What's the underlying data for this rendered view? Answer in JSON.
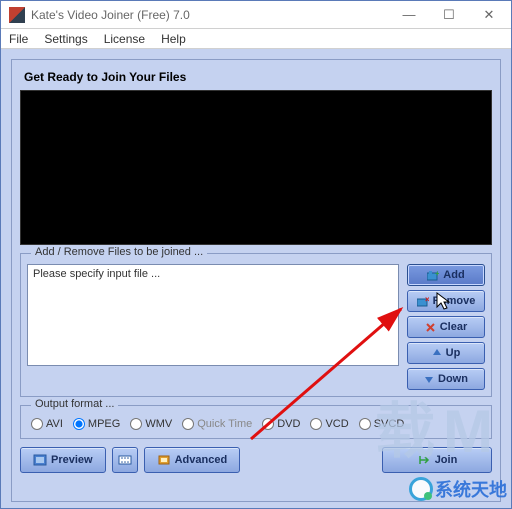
{
  "window": {
    "title": "Kate's Video Joiner (Free) 7.0"
  },
  "menu": {
    "file": "File",
    "settings": "Settings",
    "license": "License",
    "help": "Help"
  },
  "heading": "Get Ready to Join Your Files",
  "files_group": {
    "title": "Add / Remove Files to be joined ...",
    "placeholder": "Please specify input file ..."
  },
  "buttons": {
    "add": "Add",
    "remove": "Remove",
    "clear": "Clear",
    "up": "Up",
    "down": "Down",
    "preview": "Preview",
    "advanced": "Advanced",
    "join": "Join"
  },
  "formats": {
    "title": "Output format ...",
    "avi": "AVI",
    "mpeg": "MPEG",
    "wmv": "WMV",
    "quicktime": "Quick Time",
    "dvd": "DVD",
    "vcd": "VCD",
    "svcd": "SVCD",
    "selected": "MPEG"
  },
  "watermark": {
    "bg": "载M",
    "text": "系统天地"
  }
}
